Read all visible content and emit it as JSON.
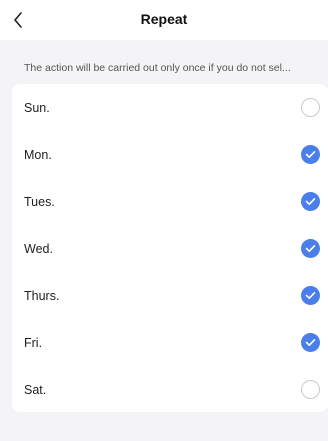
{
  "header": {
    "title": "Repeat",
    "back_icon": "chevron-left-icon"
  },
  "hint": "The action will be carried out only once if you do not sel...",
  "days": [
    {
      "label": "Sun.",
      "checked": false
    },
    {
      "label": "Mon.",
      "checked": true
    },
    {
      "label": "Tues.",
      "checked": true
    },
    {
      "label": "Wed.",
      "checked": true
    },
    {
      "label": "Thurs.",
      "checked": true
    },
    {
      "label": "Fri.",
      "checked": true
    },
    {
      "label": "Sat.",
      "checked": false
    }
  ],
  "colors": {
    "accent": "#4a7eea",
    "background": "#f4f4f6",
    "card": "#ffffff"
  }
}
